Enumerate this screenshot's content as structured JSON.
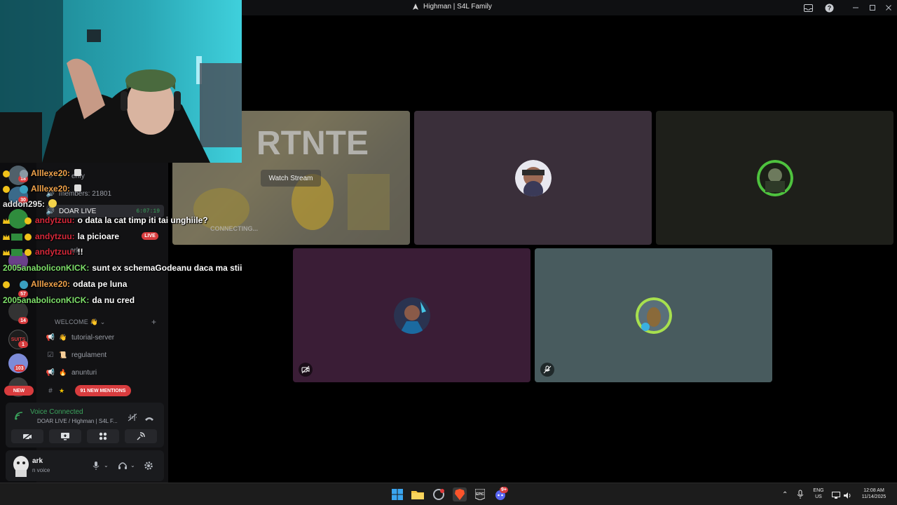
{
  "window": {
    "title": "Highman | S4L Family"
  },
  "stage": {
    "watch_stream": "Watch Stream",
    "stream_overlay": "CONNECTING..."
  },
  "sidebar": {
    "channels": {
      "verify": "erify",
      "members": "members: 21801",
      "doar_live": "DOAR LIVE",
      "doar_live_time": "6:07:19",
      "live": "LIVE",
      "user_ark": "ark",
      "category": "WELCOME",
      "tutorial": "tutorial-server",
      "regulament": "regulament",
      "anunturi": "anunturi",
      "mentions": "91 NEW MENTIONS"
    },
    "guild_badges": {
      "b1": "18",
      "b2": "30",
      "b3": "57",
      "b4": "14",
      "b5": "1",
      "b6": "103",
      "new": "NEW"
    },
    "voice": {
      "title": "Voice Connected",
      "channel": "DOAR LIVE / Highman | S4L F..."
    },
    "user": {
      "name": "ark",
      "status": "n voice"
    }
  },
  "chat": {
    "messages": [
      {
        "user": "Alllexe20:",
        "text": "",
        "color": "#f0a24a"
      },
      {
        "user": "Alllexe20:",
        "text": "",
        "color": "#f0a24a"
      },
      {
        "user": "addon295:",
        "text": "",
        "color": "#e6e6e6"
      },
      {
        "user": "andytzuu:",
        "text": "o data la cat timp iti tai unghiile?",
        "color": "#d6283a"
      },
      {
        "user": "andytzuu:",
        "text": "la picioare",
        "color": "#d6283a"
      },
      {
        "user": "andytzuu:",
        "text": "!!",
        "color": "#d6283a"
      },
      {
        "user": "2005anaboliconKICK:",
        "text": "sunt ex schemaGodeanu daca ma stii",
        "color": "#7ee06a"
      },
      {
        "user": "Alllexe20:",
        "text": "odata pe luna",
        "color": "#f0a24a"
      },
      {
        "user": "2005anaboliconKICK:",
        "text": "da nu cred",
        "color": "#7ee06a"
      }
    ]
  },
  "taskbar": {
    "discord_badge": "9+",
    "lang": "ENG",
    "region": "US",
    "time": "12:08 AM",
    "date": "11/14/2025"
  },
  "colors": {
    "accent_red": "#d83c3e",
    "voice_green": "#3ba55d"
  }
}
